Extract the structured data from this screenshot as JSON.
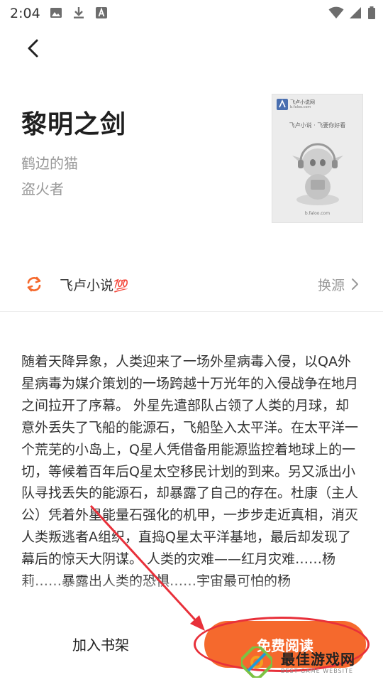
{
  "status_bar": {
    "time": "2:04"
  },
  "book": {
    "title": "黎明之剑",
    "author": "鹤边的猫",
    "category": "盗火者",
    "cover": {
      "site_name": "飞卢小说网",
      "site_url": "b.faloo.com",
      "tagline": "飞卢小说 · 飞要你好看",
      "bottom_url": "b.faloo.com"
    },
    "description": "随着天降异象，人类迎来了一场外星病毒入侵，以QA外星病毒为媒介策划的一场跨越十万光年的入侵战争在地月之间拉开了序幕。 外星先遣部队占领了人类的月球，却意外丢失了飞船的能源石，飞船坠入太平洋。在太平洋一个荒芜的小岛上，Q星人凭借备用能源监控着地球上的一切，等候着百年后Q星太空移民计划的到来。另又派出小队寻找丢失的能源石，却暴露了自己的存在。杜康（主人公）凭着外星能量石强化的机甲，一步步走近真相，消灭人类叛逃者A组织，直捣Q星太平洋基地，最后却发现了幕后的惊天大阴谋。 人类的灾难——红月灾难……杨莉……暴露出人类的恐惧……宇宙最可怕的杨"
  },
  "source": {
    "name": "飞卢小说",
    "badge": "💯",
    "switch_label": "换源"
  },
  "actions": {
    "add_to_shelf": "加入书架",
    "free_read": "免费阅读"
  },
  "watermark": {
    "text": "最佳游戏网",
    "sub": "BEST GAME WEBSITE"
  },
  "colors": {
    "accent": "#f5692d",
    "annotation": "#e8303a",
    "text_primary": "#1f1f1f",
    "text_secondary": "#999999"
  }
}
